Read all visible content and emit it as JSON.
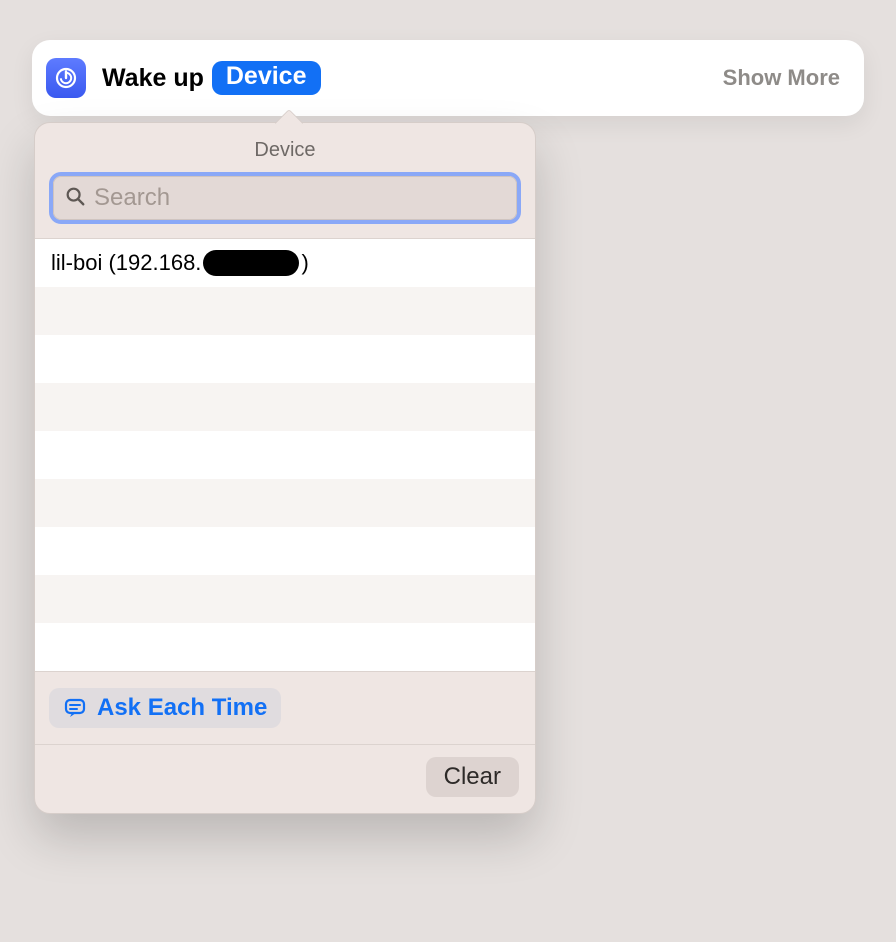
{
  "card": {
    "action_label": "Wake up",
    "token_label": "Device",
    "show_more_label": "Show More"
  },
  "popover": {
    "header_label": "Device",
    "search_placeholder": "Search",
    "ask_label": "Ask Each Time",
    "clear_label": "Clear",
    "items": [
      {
        "prefix": "lil-boi (192.168.",
        "redacted": true,
        "suffix": ")"
      },
      {
        "prefix": "",
        "redacted": false,
        "suffix": ""
      },
      {
        "prefix": "",
        "redacted": false,
        "suffix": ""
      },
      {
        "prefix": "",
        "redacted": false,
        "suffix": ""
      },
      {
        "prefix": "",
        "redacted": false,
        "suffix": ""
      },
      {
        "prefix": "",
        "redacted": false,
        "suffix": ""
      },
      {
        "prefix": "",
        "redacted": false,
        "suffix": ""
      },
      {
        "prefix": "",
        "redacted": false,
        "suffix": ""
      },
      {
        "prefix": "",
        "redacted": false,
        "suffix": ""
      }
    ]
  }
}
